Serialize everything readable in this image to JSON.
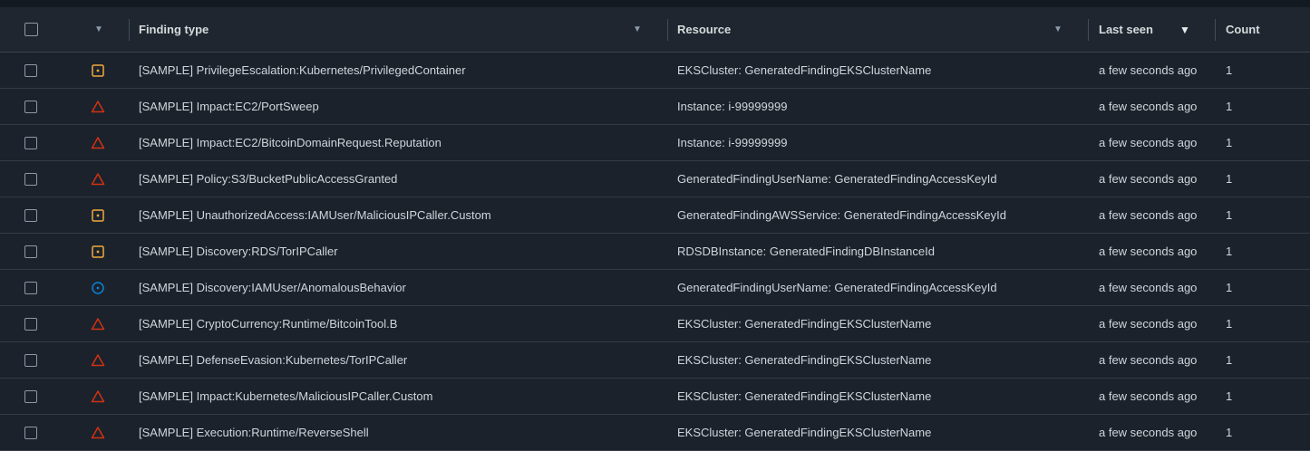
{
  "header": {
    "finding_type": "Finding type",
    "resource": "Resource",
    "last_seen": "Last seen",
    "count": "Count",
    "sort_caret": "▼"
  },
  "severity_colors": {
    "medium": "#f2a93b",
    "high": "#d13212",
    "low": "#0a84d6"
  },
  "rows": [
    {
      "severity": "medium",
      "type": "[SAMPLE] PrivilegeEscalation:Kubernetes/PrivilegedContainer",
      "resource": "EKSCluster: GeneratedFindingEKSClusterName",
      "last_seen": "a few seconds ago",
      "count": "1"
    },
    {
      "severity": "high",
      "type": "[SAMPLE] Impact:EC2/PortSweep",
      "resource": "Instance: i-99999999",
      "last_seen": "a few seconds ago",
      "count": "1"
    },
    {
      "severity": "high",
      "type": "[SAMPLE] Impact:EC2/BitcoinDomainRequest.Reputation",
      "resource": "Instance: i-99999999",
      "last_seen": "a few seconds ago",
      "count": "1"
    },
    {
      "severity": "high",
      "type": "[SAMPLE] Policy:S3/BucketPublicAccessGranted",
      "resource": "GeneratedFindingUserName: GeneratedFindingAccessKeyId",
      "last_seen": "a few seconds ago",
      "count": "1"
    },
    {
      "severity": "medium",
      "type": "[SAMPLE] UnauthorizedAccess:IAMUser/MaliciousIPCaller.Custom",
      "resource": "GeneratedFindingAWSService: GeneratedFindingAccessKeyId",
      "last_seen": "a few seconds ago",
      "count": "1"
    },
    {
      "severity": "medium",
      "type": "[SAMPLE] Discovery:RDS/TorIPCaller",
      "resource": "RDSDBInstance: GeneratedFindingDBInstanceId",
      "last_seen": "a few seconds ago",
      "count": "1"
    },
    {
      "severity": "low",
      "type": "[SAMPLE] Discovery:IAMUser/AnomalousBehavior",
      "resource": "GeneratedFindingUserName: GeneratedFindingAccessKeyId",
      "last_seen": "a few seconds ago",
      "count": "1"
    },
    {
      "severity": "high",
      "type": "[SAMPLE] CryptoCurrency:Runtime/BitcoinTool.B",
      "resource": "EKSCluster: GeneratedFindingEKSClusterName",
      "last_seen": "a few seconds ago",
      "count": "1"
    },
    {
      "severity": "high",
      "type": "[SAMPLE] DefenseEvasion:Kubernetes/TorIPCaller",
      "resource": "EKSCluster: GeneratedFindingEKSClusterName",
      "last_seen": "a few seconds ago",
      "count": "1"
    },
    {
      "severity": "high",
      "type": "[SAMPLE] Impact:Kubernetes/MaliciousIPCaller.Custom",
      "resource": "EKSCluster: GeneratedFindingEKSClusterName",
      "last_seen": "a few seconds ago",
      "count": "1"
    },
    {
      "severity": "high",
      "type": "[SAMPLE] Execution:Runtime/ReverseShell",
      "resource": "EKSCluster: GeneratedFindingEKSClusterName",
      "last_seen": "a few seconds ago",
      "count": "1"
    }
  ]
}
